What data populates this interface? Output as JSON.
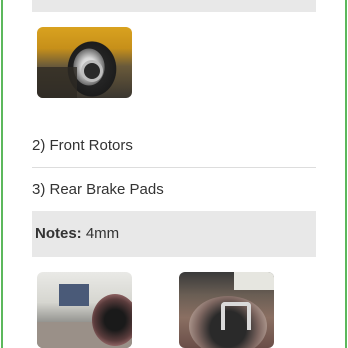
{
  "items": {
    "front_rotors": "2) Front Rotors",
    "rear_brake_pads": "3) Rear Brake Pads"
  },
  "notes": {
    "label": "Notes:",
    "value": " 4mm"
  },
  "photos": [
    {
      "name": "rotor-photo"
    },
    {
      "name": "garage-rotor-photo"
    },
    {
      "name": "brake-pad-photo"
    }
  ],
  "colors": {
    "accent_border": "#5cb85c",
    "band_bg": "#e8e8e8",
    "text": "#333333"
  }
}
